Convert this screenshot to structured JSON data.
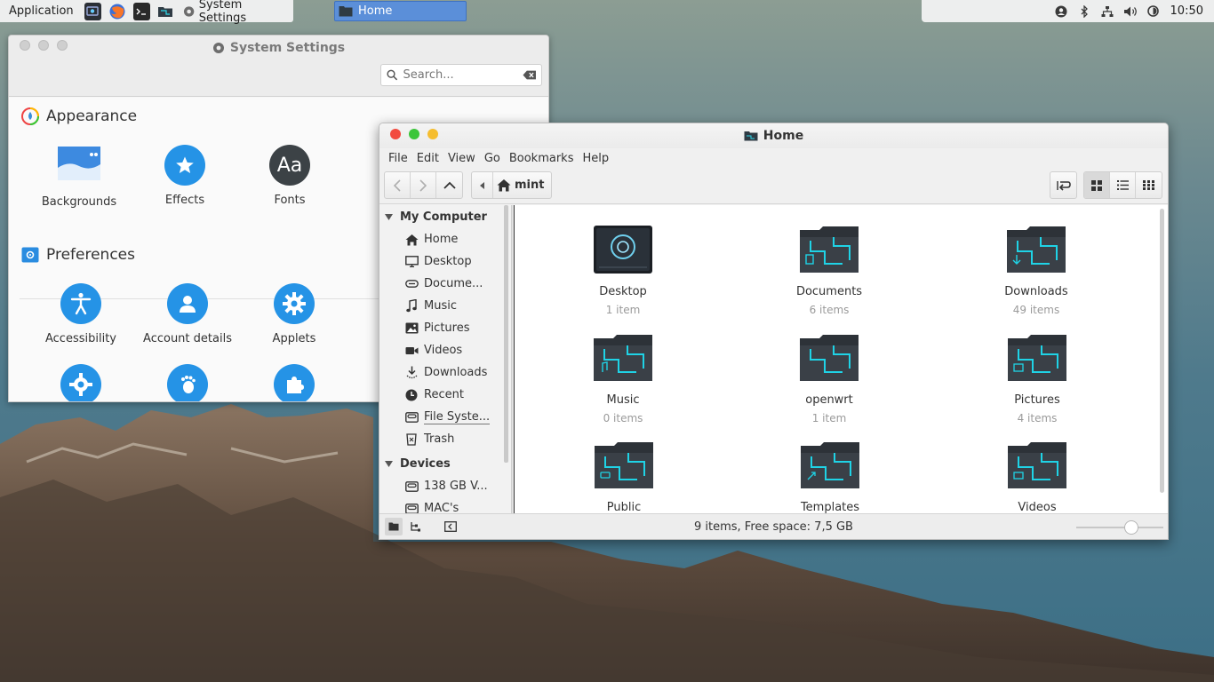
{
  "panel": {
    "menu_label": "Application",
    "taskbar_settings": "System Settings",
    "taskbar_home": "Home",
    "clock": "10:50"
  },
  "settings_window": {
    "title": "System Settings",
    "search_placeholder": "Search...",
    "appearance_title": "Appearance",
    "appearance_items": [
      "Backgrounds",
      "Effects",
      "Fonts"
    ],
    "preferences_title": "Preferences",
    "preferences_items": [
      "Accessibility",
      "Account details",
      "Applets"
    ]
  },
  "files_window": {
    "title": "Home",
    "menu": [
      "File",
      "Edit",
      "View",
      "Go",
      "Bookmarks",
      "Help"
    ],
    "path_crumb": "mint",
    "sidebar": {
      "my_computer_header": "My Computer",
      "my_computer_items": [
        "Home",
        "Desktop",
        "Docume...",
        "Music",
        "Pictures",
        "Videos",
        "Downloads",
        "Recent",
        "File Syste...",
        "Trash"
      ],
      "devices_header": "Devices",
      "devices_items": [
        "138 GB V...",
        "MAC's"
      ]
    },
    "files": [
      {
        "name": "Desktop",
        "count": "1 item"
      },
      {
        "name": "Documents",
        "count": "6 items"
      },
      {
        "name": "Downloads",
        "count": "49 items"
      },
      {
        "name": "Music",
        "count": "0 items"
      },
      {
        "name": "openwrt",
        "count": "1 item"
      },
      {
        "name": "Pictures",
        "count": "4 items"
      },
      {
        "name": "Public",
        "count": ""
      },
      {
        "name": "Templates",
        "count": ""
      },
      {
        "name": "Videos",
        "count": ""
      }
    ],
    "status": "9 items, Free space: 7,5 GB",
    "zoom_level": 0.62
  },
  "colors": {
    "accent_blue": "#2a8ce0",
    "folder_teal": "#1fd3e6",
    "close": "#f24b3f",
    "minimize": "#f5bd2f",
    "maximize": "#3cc63a"
  }
}
